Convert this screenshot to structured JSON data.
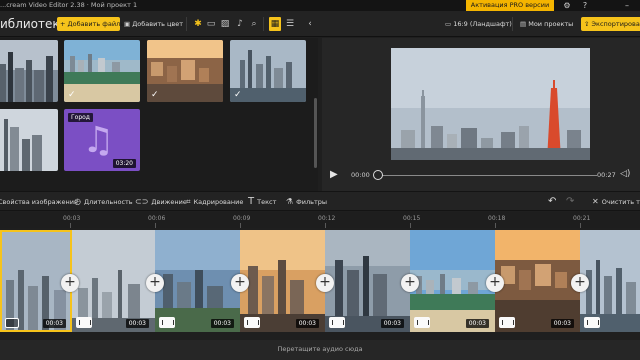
{
  "window": {
    "title": "...cream Video Editor 2.38  ·  Мой проект 1",
    "pro_label": "Активация PRO версии",
    "settings_icon": "gear-icon",
    "help_icon": "question-icon",
    "minimize_icon": "minimize-icon"
  },
  "toolbar": {
    "library_title": "иблиотека",
    "add_files": "+ Добавить файлы",
    "add_color": "Добавить цвет",
    "aspect": "16:9 (Ландшафт)",
    "my_projects": "Мои проекты",
    "export": "Экспортировать в"
  },
  "library": {
    "items": [
      {
        "kind": "city",
        "checked": false
      },
      {
        "kind": "beach-city",
        "checked": true
      },
      {
        "kind": "old-city",
        "checked": true
      },
      {
        "kind": "skyline",
        "checked": true
      },
      {
        "kind": "downtown",
        "checked": false
      },
      {
        "kind": "audio",
        "label": "Город",
        "duration": "03:20"
      }
    ]
  },
  "preview": {
    "time_start": "00:00",
    "time_end": "00:27",
    "progress": 0.0
  },
  "edit_toolbar": {
    "props": "Свойства изображения",
    "duration": "Длительность",
    "motion": "Движение",
    "crop": "Кадрирование",
    "text": "Текст",
    "filters": "Фильтры",
    "clear": "Очистить тайм"
  },
  "timeline": {
    "ticks": [
      "00:03",
      "00:06",
      "00:09",
      "00:12",
      "00:15",
      "00:18",
      "00:21"
    ],
    "clips": [
      {
        "duration": "00:03",
        "selected": true
      },
      {
        "duration": "00:03",
        "selected": false
      },
      {
        "duration": "00:03",
        "selected": false
      },
      {
        "duration": "00:03",
        "selected": false
      },
      {
        "duration": "00:03",
        "selected": false
      },
      {
        "duration": "00:03",
        "selected": false
      },
      {
        "duration": "00:03",
        "selected": false
      },
      {
        "duration": "",
        "selected": false
      }
    ]
  },
  "audio": {
    "hint": "Перетащите аудио сюда"
  },
  "colors": {
    "accent": "#f6c31b",
    "pro": "#f4b400",
    "audio_thumb": "#7b4fc4"
  }
}
